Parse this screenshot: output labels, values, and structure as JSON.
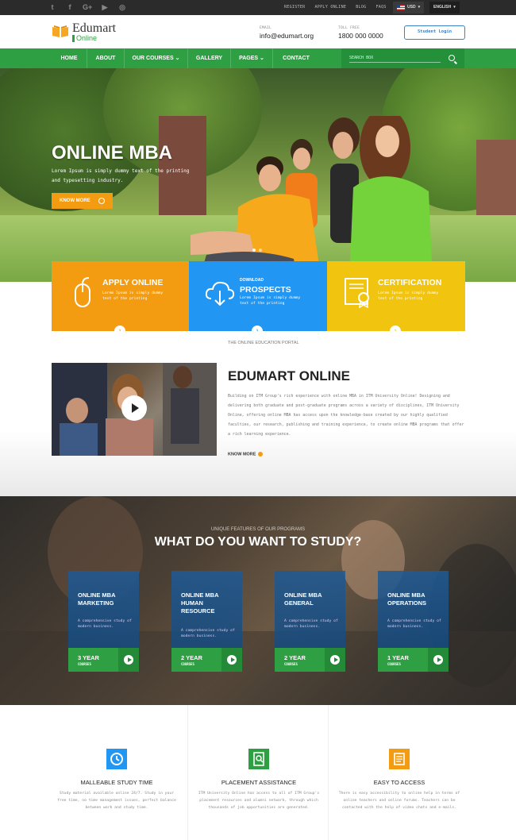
{
  "topbar": {
    "social": [
      "twitter-icon",
      "facebook-icon",
      "google-plus-icon",
      "youtube-icon",
      "instagram-icon"
    ],
    "links": [
      "REGISTER",
      "APPLY ONLINE",
      "BLOG",
      "FAQS"
    ],
    "currency": "USD",
    "language": "ENGLISH"
  },
  "header": {
    "logo_title": "Edumart",
    "logo_sub": "Online",
    "email_label": "EMAIL",
    "email": "info@edumart.org",
    "phone_label": "TOLL FREE",
    "phone": "1800 000 0000",
    "login_label": "Student Login"
  },
  "nav": {
    "items": [
      "HOME",
      "ABOUT",
      "OUR COURSES",
      "GALLERY",
      "PAGES",
      "CONTACT"
    ],
    "search_placeholder": "SEARCH BOX"
  },
  "hero": {
    "title": "ONLINE MBA",
    "text": "Lorem Ipsum is simply dummy text of the printing and typesetting industry.",
    "button": "KNOW MORE"
  },
  "features": [
    {
      "title": "APPLY ONLINE",
      "kicker": "",
      "text": "Lorem Ipsum is simply dummy text of the printing",
      "color": "#f39c12"
    },
    {
      "title": "PROSPECTS",
      "kicker": "DOWNLOAD",
      "text": "Lorem Ipsum is simply dummy text of the printing",
      "color": "#2196f3"
    },
    {
      "title": "CERTIFICATION",
      "kicker": "",
      "text": "Lorem Ipsum is simply dummy text of the printing",
      "color": "#f1c40f"
    }
  ],
  "about": {
    "kicker": "THE ONLINE EDUCATION PORTAL",
    "title": "EDUMART ONLINE",
    "text": "Building on ITM Group's rich experience with online MBA in ITM University Online! Designing and delivering both graduate and post-graduate programs across a variety of disciplines, ITM University Online, offering online MBA has access upon the knowledge-base created by our highly qualified faculties, our research, publishing and training experience, to create online MBA programs that offer a rich learning experience.",
    "more": "KNOW MORE"
  },
  "study": {
    "kicker": "UNIQUE FEATURES OF OUR PROGRAMS",
    "title": "WHAT DO YOU WANT TO STUDY?",
    "cards": [
      {
        "title": "ONLINE MBA MARKETING",
        "desc": "A comprehensive study of modern business.",
        "years": "3 YEAR",
        "label": "COURSES"
      },
      {
        "title": "ONLINE MBA HUMAN RESOURCE",
        "desc": "A comprehensive study of modern business.",
        "years": "2 YEAR",
        "label": "COURSES"
      },
      {
        "title": "ONLINE MBA GENERAL",
        "desc": "A comprehensive study of modern business.",
        "years": "2 YEAR",
        "label": "COURSES"
      },
      {
        "title": "ONLINE MBA OPERATIONS",
        "desc": "A comprehensive study of modern business.",
        "years": "1 YEAR",
        "label": "COURSES"
      }
    ]
  },
  "highlights": [
    {
      "title": "MALLEABLE STUDY TIME",
      "text": "Study material available online 24/7. Study in your free time, no time management issues, perfect balance between work and study time.",
      "color": "#2196f3",
      "icon": "clock-icon"
    },
    {
      "title": "PLACEMENT ASSISTANCE",
      "text": "ITM University Online has access to all of ITM Group's placement resources and alumni network, through which thousands of job opportunities are generated.",
      "color": "#2ea043",
      "icon": "document-search-icon"
    },
    {
      "title": "EASY TO ACCESS",
      "text": "There is easy accessibility to online help in terms of online teachers and online forums. Teachers can be contacted with the help of video chats and e-mails.",
      "color": "#f39c12",
      "icon": "notes-icon"
    }
  ]
}
